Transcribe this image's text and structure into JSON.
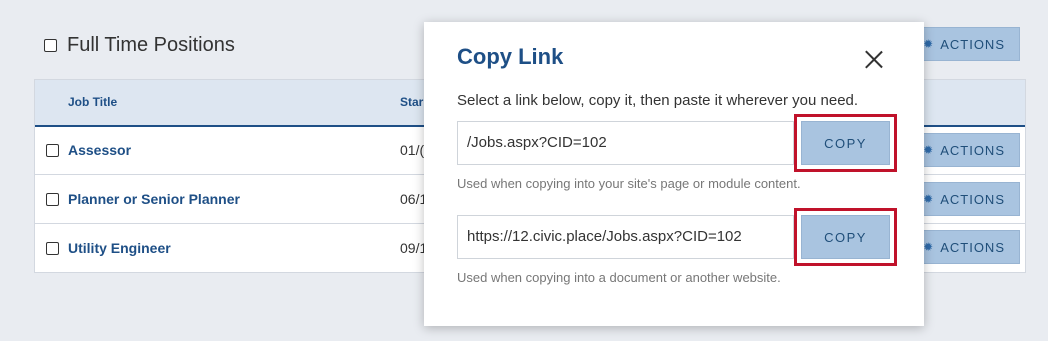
{
  "page": {
    "title": "Full Time Positions",
    "actions_label": "ACTIONS"
  },
  "table": {
    "headers": [
      "Job Title",
      "Star"
    ],
    "rows": [
      {
        "title": "Assessor",
        "date": "01/("
      },
      {
        "title": "Planner or Senior Planner",
        "date": "06/1"
      },
      {
        "title": "Utility Engineer",
        "date": "09/1"
      }
    ]
  },
  "modal": {
    "title": "Copy Link",
    "instructions": "Select a link below, copy it, then paste it wherever you need.",
    "links": [
      {
        "value": "/Jobs.aspx?CID=102",
        "copy_label": "COPY",
        "hint": "Used when copying into your site's page or module content."
      },
      {
        "value": "https://12.civic.place/Jobs.aspx?CID=102",
        "copy_label": "COPY",
        "hint": "Used when copying into a document or another website."
      }
    ]
  },
  "colors": {
    "accent": "#1e4f86",
    "button_bg": "#a9c4e0",
    "highlight": "#c0122a"
  },
  "icons": [
    "checkbox-icon",
    "gear-icon",
    "close-icon"
  ]
}
